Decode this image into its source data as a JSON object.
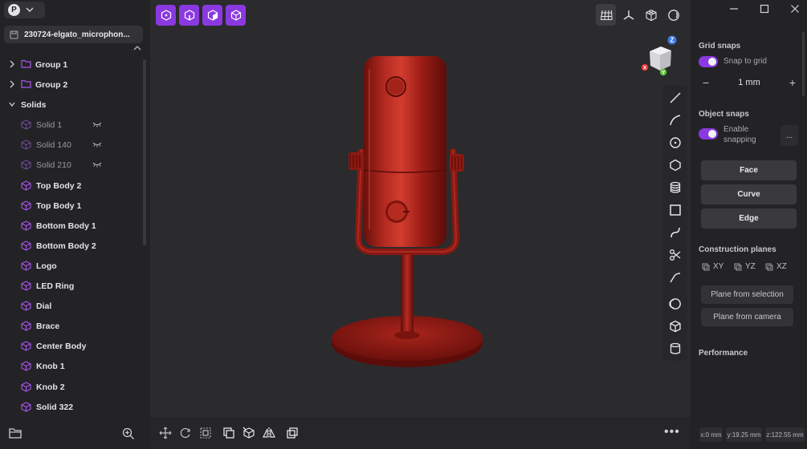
{
  "app": {
    "avatar_initial": "P",
    "document_title": "230724-elgato_microphon..."
  },
  "outliner": {
    "items": [
      {
        "label": "Group 1",
        "kind": "group"
      },
      {
        "label": "Group 2",
        "kind": "group"
      },
      {
        "label": "Solids",
        "kind": "section"
      },
      {
        "label": "Solid 1",
        "kind": "solid",
        "hidden": true
      },
      {
        "label": "Solid 140",
        "kind": "solid",
        "hidden": true
      },
      {
        "label": "Solid 210",
        "kind": "solid",
        "hidden": true
      },
      {
        "label": "Top Body 2",
        "kind": "solid"
      },
      {
        "label": "Top Body 1",
        "kind": "solid"
      },
      {
        "label": "Bottom Body 1",
        "kind": "solid"
      },
      {
        "label": "Bottom Body 2",
        "kind": "solid"
      },
      {
        "label": "Logo",
        "kind": "solid"
      },
      {
        "label": "LED Ring",
        "kind": "solid"
      },
      {
        "label": "Dial",
        "kind": "solid"
      },
      {
        "label": "Brace",
        "kind": "solid"
      },
      {
        "label": "Center Body",
        "kind": "solid"
      },
      {
        "label": "Knob 1",
        "kind": "solid"
      },
      {
        "label": "Knob 2",
        "kind": "solid"
      },
      {
        "label": "Solid 322",
        "kind": "solid"
      }
    ]
  },
  "nav_cube": {
    "x_axis": "X",
    "y_axis": "Y",
    "z_axis": "Z"
  },
  "viewport": {
    "model_color": "#9c1d16"
  },
  "settings": {
    "grid_snaps_title": "Grid snaps",
    "snap_to_grid_label": "Snap to grid",
    "snap_to_grid_on": true,
    "grid_size": "1 mm",
    "minus": "−",
    "plus": "+",
    "object_snaps_title": "Object snaps",
    "enable_snapping_label": "Enable snapping",
    "enable_snapping_on": true,
    "more_label": "...",
    "face_label": "Face",
    "curve_label": "Curve",
    "edge_label": "Edge",
    "construction_planes_title": "Construction planes",
    "plane_xy": "XY",
    "plane_yz": "YZ",
    "plane_xz": "XZ",
    "plane_from_selection": "Plane from selection",
    "plane_from_camera": "Plane from camera",
    "performance_title": "Performance",
    "coord_x": "x:0 mm",
    "coord_y": "y:19.25 mm",
    "coord_z": "z:122.55 mm"
  },
  "bottom": {
    "more": "•••"
  },
  "colors": {
    "accent": "#8a39e0",
    "panel": "#232325",
    "viewport": "#2b2b2e"
  }
}
